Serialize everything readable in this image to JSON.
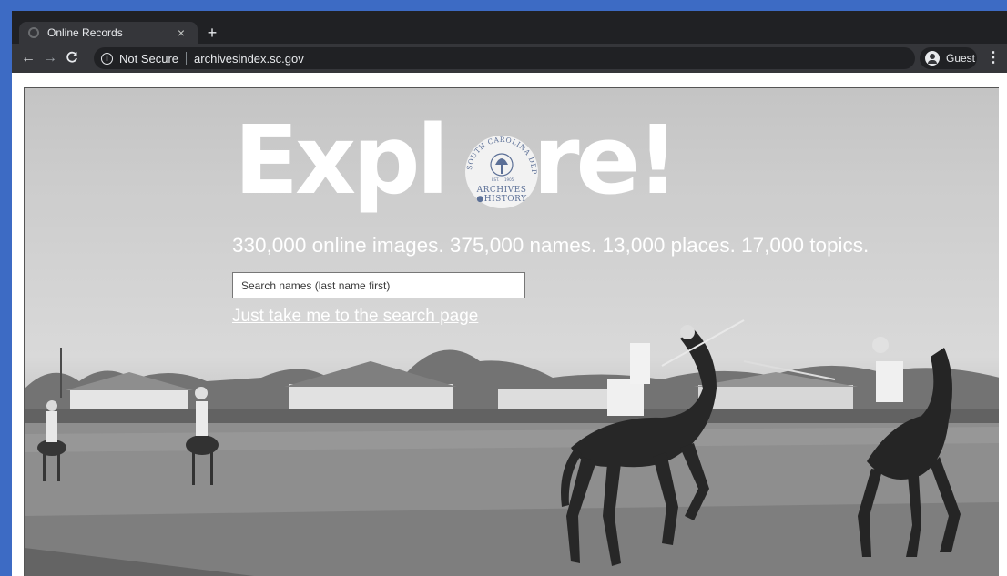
{
  "browser": {
    "tab": {
      "title": "Online Records",
      "close": "×"
    },
    "new_tab": "+",
    "nav": {
      "back": "←",
      "forward": "→",
      "reload": "C"
    },
    "address": {
      "info_icon": "ⓘ",
      "security_label": "Not Secure",
      "url": "archivesindex.sc.gov"
    },
    "profile": {
      "label": "Guest"
    },
    "menu": "⋮"
  },
  "hero": {
    "headline_left": "Expl",
    "headline_right": "re!",
    "seal": {
      "ring_text": "SOUTH CAROLINA DEPARTMENT OF",
      "year_left": "EST.",
      "year_right": "1905",
      "line1": "ARCHIVES",
      "line2": "HISTORY"
    },
    "stats": "330,000 online images. 375,000 names. 13,000 places. 17,000 topics.",
    "search": {
      "placeholder": "Search names (last name first)",
      "value": ""
    },
    "link": "Just take me to the search page"
  },
  "icons": {
    "favicon": "globe-icon",
    "back": "arrow-left-icon",
    "forward": "arrow-right-icon",
    "reload": "reload-icon",
    "info": "info-icon",
    "profile": "person-icon",
    "menu": "more-vert-icon"
  },
  "colors": {
    "desktop_bg": "#3d6bc4",
    "chrome_dark": "#202124",
    "chrome_mid": "#35363a",
    "seal_blue": "#5b6f96"
  }
}
